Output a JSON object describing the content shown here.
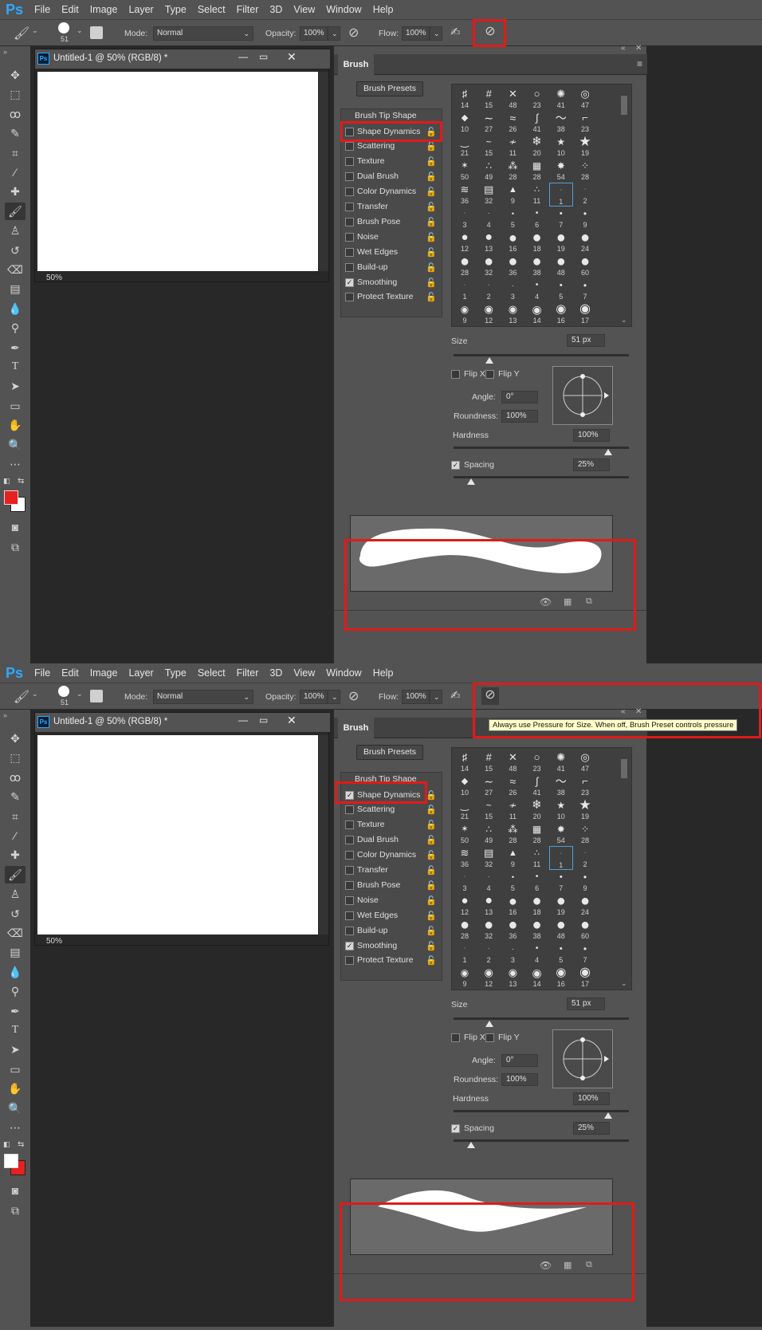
{
  "app": {
    "logo": "Ps"
  },
  "menu": [
    "File",
    "Edit",
    "Image",
    "Layer",
    "Type",
    "Select",
    "Filter",
    "3D",
    "View",
    "Window",
    "Help"
  ],
  "options": {
    "brush_size": "51",
    "mode_label": "Mode:",
    "mode_value": "Normal",
    "opacity_label": "Opacity:",
    "opacity_value": "100%",
    "flow_label": "Flow:",
    "flow_value": "100%"
  },
  "document": {
    "tab_title": "Untitled-1 @ 50% (RGB/8) *",
    "zoom": "50%"
  },
  "brush_panel": {
    "tab_label": "Brush",
    "presets_button": "Brush Presets",
    "tip_shape_label": "Brush Tip Shape",
    "options": [
      {
        "label": "Shape Dynamics"
      },
      {
        "label": "Scattering"
      },
      {
        "label": "Texture"
      },
      {
        "label": "Dual Brush"
      },
      {
        "label": "Color Dynamics"
      },
      {
        "label": "Transfer"
      },
      {
        "label": "Brush Pose"
      },
      {
        "label": "Noise"
      },
      {
        "label": "Wet Edges"
      },
      {
        "label": "Build-up"
      },
      {
        "label": "Smoothing"
      },
      {
        "label": "Protect Texture"
      }
    ],
    "tip_sizes": [
      "14",
      "15",
      "48",
      "23",
      "41",
      "47",
      "10",
      "27",
      "26",
      "41",
      "38",
      "23",
      "21",
      "15",
      "11",
      "20",
      "10",
      "19",
      "50",
      "49",
      "28",
      "28",
      "54",
      "28",
      "36",
      "32",
      "9",
      "11",
      "1",
      "2",
      "3",
      "4",
      "5",
      "6",
      "7",
      "9",
      "12",
      "13",
      "16",
      "18",
      "19",
      "24",
      "28",
      "32",
      "36",
      "38",
      "48",
      "60",
      "1",
      "2",
      "3",
      "4",
      "5",
      "7",
      "9",
      "12",
      "13",
      "14",
      "16",
      "17"
    ],
    "size_label": "Size",
    "size_value": "51 px",
    "flip_x": "Flip X",
    "flip_y": "Flip Y",
    "angle_label": "Angle:",
    "angle_value": "0°",
    "roundness_label": "Roundness:",
    "roundness_value": "100%",
    "hardness_label": "Hardness",
    "hardness_value": "100%",
    "spacing_label": "Spacing",
    "spacing_value": "25%"
  },
  "screenshot1": {
    "shape_dynamics_checked": false,
    "foreground_color": "#e82020",
    "background_color": "#ffffff"
  },
  "screenshot2": {
    "shape_dynamics_checked": true,
    "foreground_color": "#ffffff",
    "background_color": "#e82020",
    "tooltip": "Always use Pressure for Size. When off, Brush Preset controls pressure"
  },
  "highlight_color": "#e01b1b"
}
